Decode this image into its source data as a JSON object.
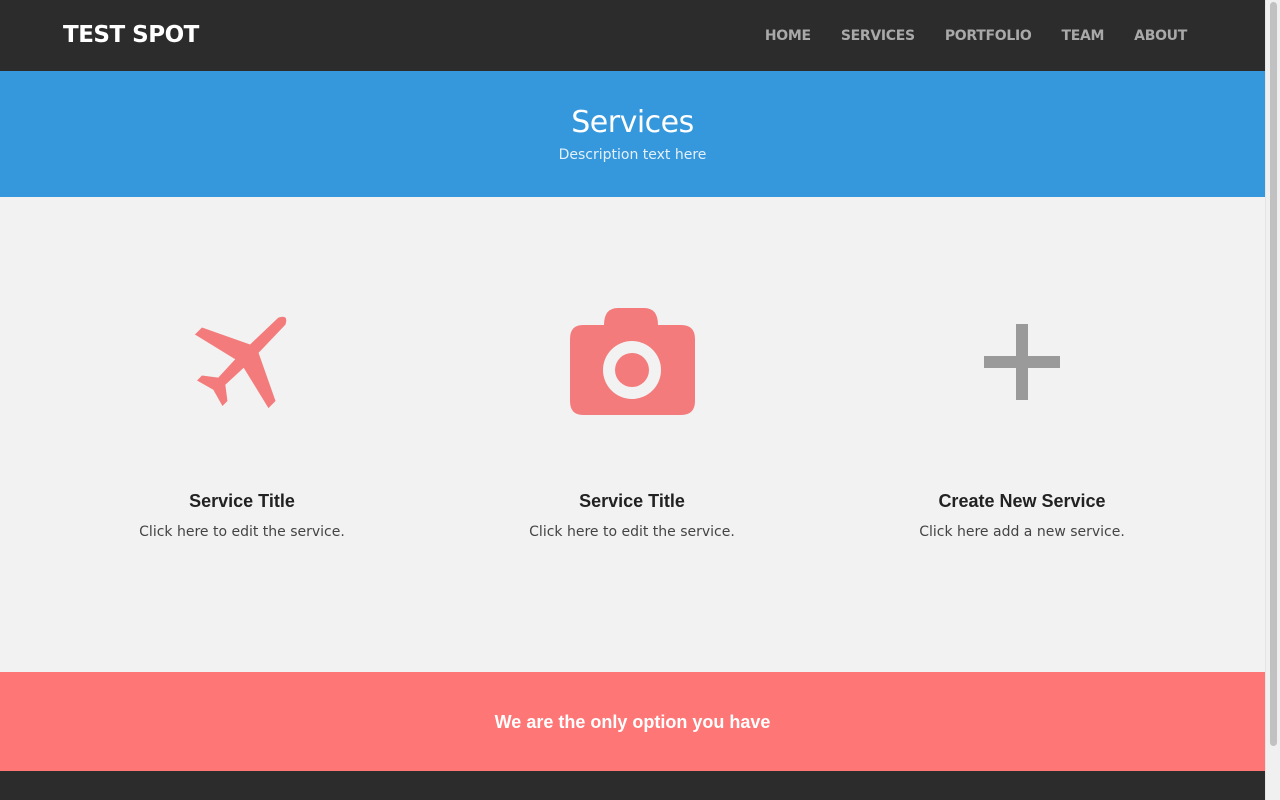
{
  "brand": "TEST SPOT",
  "nav": [
    "HOME",
    "SERVICES",
    "PORTFOLIO",
    "TEAM",
    "ABOUT"
  ],
  "hero": {
    "title": "Services",
    "description": "Description text here"
  },
  "services": [
    {
      "icon": "airplane-icon",
      "title": "Service Title",
      "text": "Click here to edit the service."
    },
    {
      "icon": "camera-icon",
      "title": "Service Title",
      "text": "Click here to edit the service."
    },
    {
      "icon": "plus-icon",
      "title": "Create New Service",
      "text": "Click here add a new service."
    }
  ],
  "callout": {
    "text": "We are the only option you have"
  },
  "colors": {
    "navbar": "#2c2c2c",
    "hero": "#3598dc",
    "icon_accent": "#f47b7b",
    "icon_muted": "#9a9a9a",
    "callout": "#ff7676"
  }
}
